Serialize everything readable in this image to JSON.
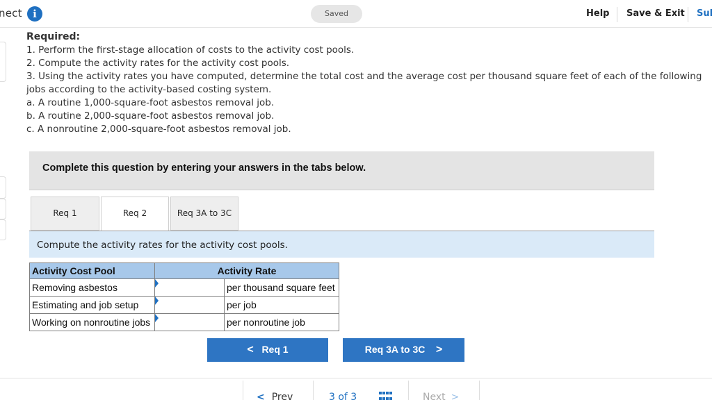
{
  "topbar": {
    "brand": "nect",
    "saved": "Saved",
    "help": "Help",
    "save_exit": "Save & Exit",
    "submit": "Sub"
  },
  "question": {
    "heading": "Required:",
    "lines": [
      "1. Perform the first-stage allocation of costs to the activity cost pools.",
      "2. Compute the activity rates for the activity cost pools.",
      "3. Using the activity rates you have computed, determine the total cost and the average cost per thousand square feet of each of the following jobs according to the activity-based costing system.",
      "a. A routine 1,000-square-foot asbestos removal job.",
      "b. A routine 2,000-square-foot asbestos removal job.",
      "c. A nonroutine 2,000-square-foot asbestos removal job."
    ]
  },
  "banner": "Complete this question by entering your answers in the tabs below.",
  "tabs": [
    {
      "label": "Req 1",
      "active": false
    },
    {
      "label": "Req 2",
      "active": true
    },
    {
      "label": "Req 3A to 3C",
      "active": false
    }
  ],
  "prompt": "Compute the activity rates for the activity cost pools.",
  "table": {
    "headers": [
      "Activity Cost Pool",
      "Activity Rate"
    ],
    "rows": [
      {
        "pool": "Removing asbestos",
        "value": "",
        "unit": "per thousand square feet"
      },
      {
        "pool": "Estimating and job setup",
        "value": "",
        "unit": "per job"
      },
      {
        "pool": "Working on nonroutine jobs",
        "value": "",
        "unit": "per nonroutine job"
      }
    ]
  },
  "nav": {
    "prev_label": "Req 1",
    "prev_chevron": "<",
    "next_label": "Req 3A to 3C",
    "next_chevron": ">"
  },
  "pager": {
    "prev": "Prev",
    "prev_chevron": "<",
    "count": "3 of 3",
    "next": "Next",
    "next_chevron": ">"
  },
  "colors": {
    "accent": "#1f70c1",
    "button": "#2e75c3",
    "table_header": "#a7c8ea",
    "prompt_band": "#daeaf8",
    "banner": "#e4e4e4"
  }
}
